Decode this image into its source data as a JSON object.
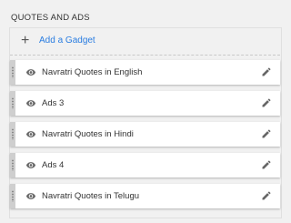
{
  "section": {
    "title": "QUOTES AND ADS",
    "add_gadget_label": "Add a Gadget"
  },
  "gadgets": [
    {
      "name": "Navratri Quotes in English"
    },
    {
      "name": "Ads 3"
    },
    {
      "name": "Navratri Quotes in Hindi"
    },
    {
      "name": "Ads 4"
    },
    {
      "name": "Navratri Quotes in Telugu"
    }
  ],
  "colors": {
    "background": "#f1f1f1",
    "link": "#2a7de1",
    "icon": "#666666",
    "grip": "#cfcfcf"
  },
  "icons": {
    "add": "plus-icon",
    "visibility": "eye-icon",
    "edit": "pencil-icon",
    "drag": "drag-handle-icon"
  }
}
